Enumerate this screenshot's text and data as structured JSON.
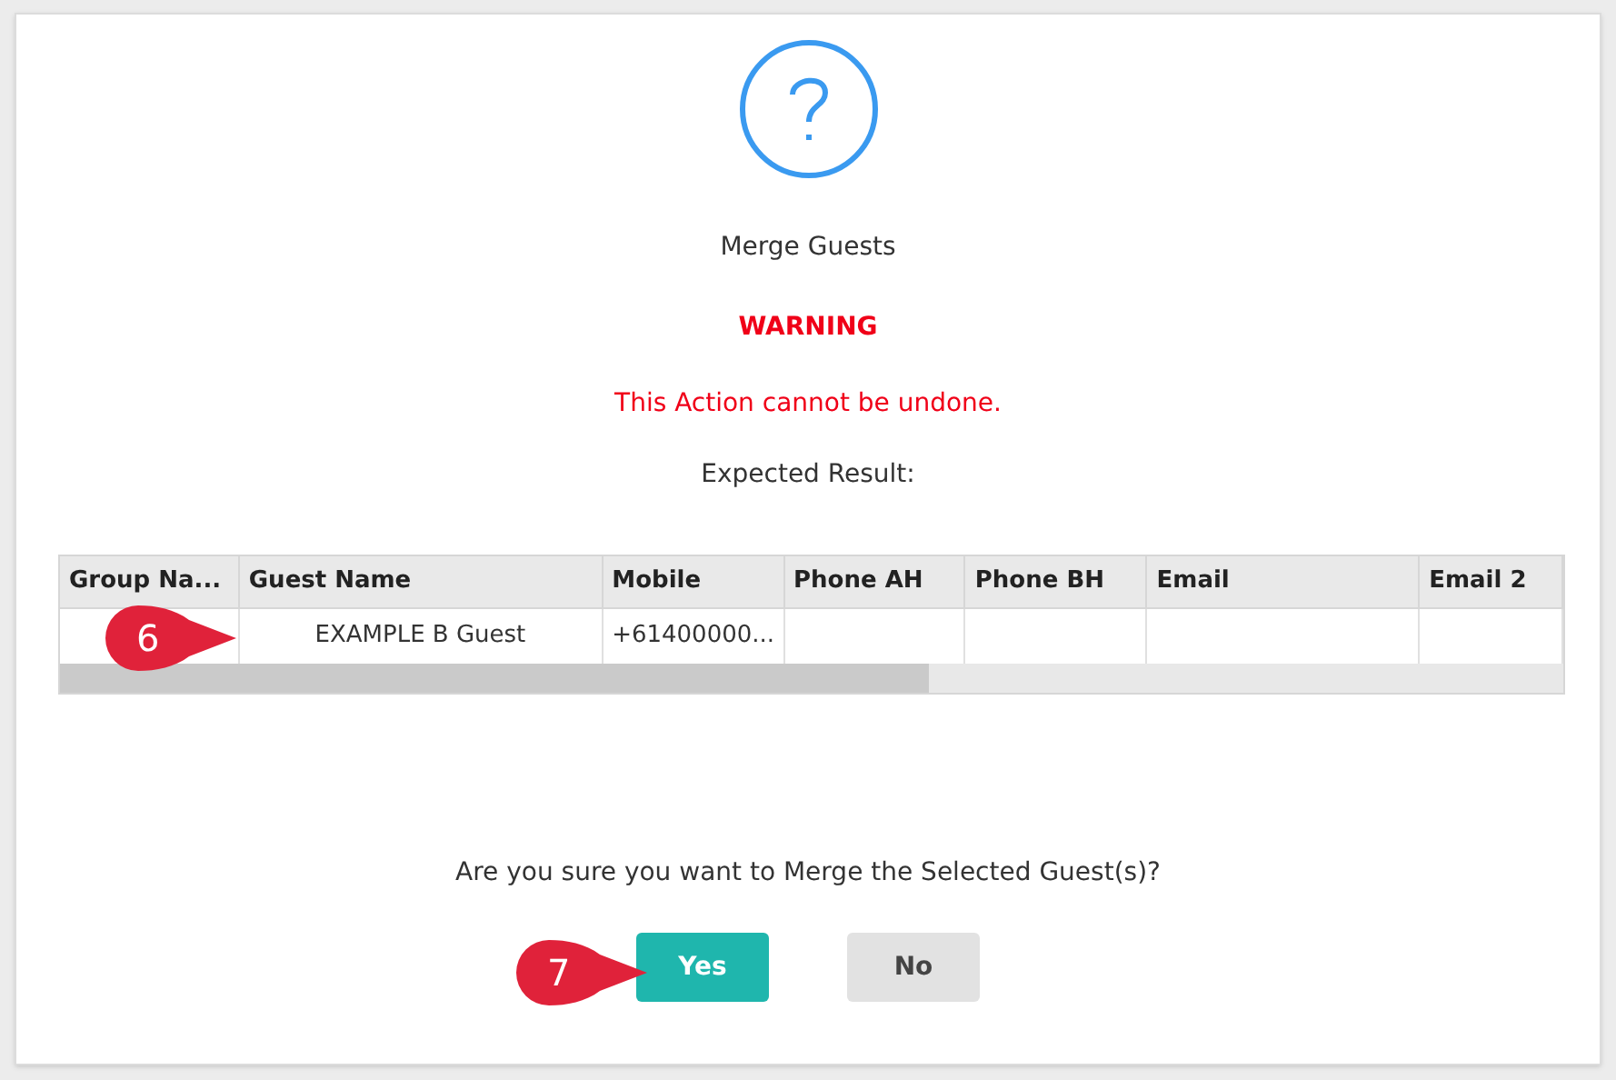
{
  "dialog": {
    "title": "Merge Guests",
    "warning_title": "WARNING",
    "warning_text": "This Action cannot be undone.",
    "result_label": "Expected Result:"
  },
  "table": {
    "columns": [
      "Group Na...",
      "Guest Name",
      "Mobile",
      "Phone AH",
      "Phone BH",
      "Email",
      "Email 2"
    ],
    "rows": [
      {
        "cells": [
          "",
          "EXAMPLE B Guest",
          "+61400000...",
          "",
          "",
          "",
          ""
        ],
        "callout": "6"
      }
    ]
  },
  "question": "Are you sure you want to Merge the Selected Guest(s)?",
  "buttons": [
    {
      "kind": "primary",
      "label": "Yes",
      "callout": "7"
    },
    {
      "kind": "secondary",
      "label": "No"
    }
  ]
}
